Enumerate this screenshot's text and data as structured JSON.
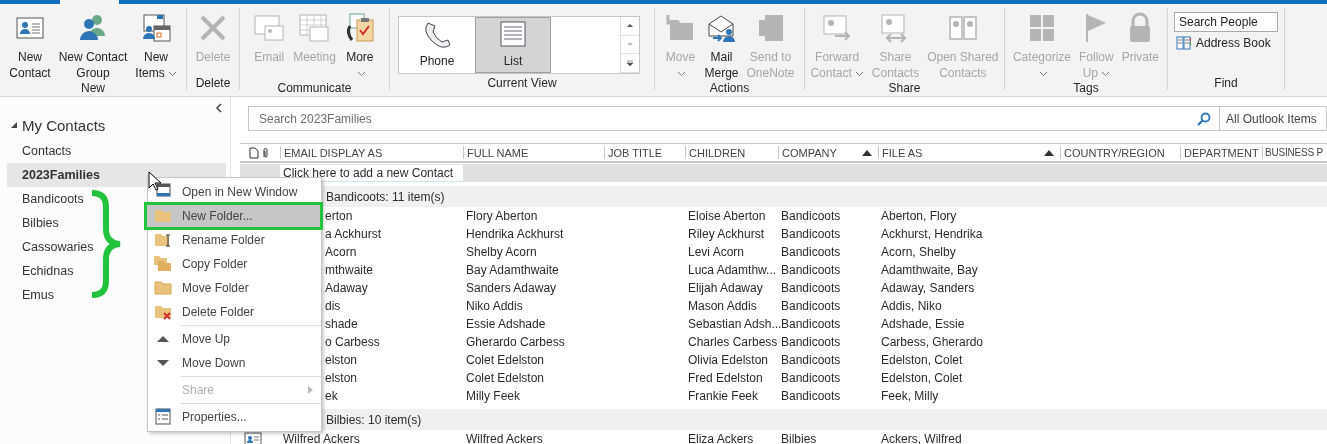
{
  "ribbon": {
    "groups": [
      {
        "label": "New",
        "buttons": [
          {
            "label": "New\nContact",
            "disabled": false,
            "dropdown": false
          },
          {
            "label": "New Contact\nGroup",
            "disabled": false,
            "dropdown": false
          },
          {
            "label": "New\nItems",
            "disabled": false,
            "dropdown": true
          }
        ]
      },
      {
        "label": "Delete",
        "buttons": [
          {
            "label": "Delete",
            "disabled": true,
            "dropdown": false
          }
        ]
      },
      {
        "label": "Communicate",
        "buttons": [
          {
            "label": "Email",
            "disabled": true,
            "dropdown": false
          },
          {
            "label": "Meeting",
            "disabled": true,
            "dropdown": false
          },
          {
            "label": "More",
            "disabled": false,
            "dropdown": true
          }
        ]
      },
      {
        "label": "Current View",
        "gallery": [
          {
            "label": "Phone",
            "selected": false
          },
          {
            "label": "List",
            "selected": true
          }
        ]
      },
      {
        "label": "Actions",
        "buttons": [
          {
            "label": "Move",
            "disabled": true,
            "dropdown": true
          },
          {
            "label": "Mail\nMerge",
            "disabled": false,
            "dropdown": false
          },
          {
            "label": "Send to\nOneNote",
            "disabled": true,
            "dropdown": false
          }
        ]
      },
      {
        "label": "Share",
        "buttons": [
          {
            "label": "Forward\nContact",
            "disabled": true,
            "dropdown": true
          },
          {
            "label": "Share\nContacts",
            "disabled": true,
            "dropdown": false
          },
          {
            "label": "Open Shared\nContacts",
            "disabled": true,
            "dropdown": false
          }
        ]
      },
      {
        "label": "Tags",
        "buttons": [
          {
            "label": "Categorize",
            "disabled": true,
            "dropdown": true
          },
          {
            "label": "Follow\nUp",
            "disabled": true,
            "dropdown": true
          },
          {
            "label": "Private",
            "disabled": true,
            "dropdown": false
          }
        ]
      },
      {
        "label": "Find",
        "search": {
          "placeholder": "Search People"
        },
        "links": [
          {
            "label": "Address Book"
          }
        ]
      }
    ]
  },
  "sidebar": {
    "header": {
      "label": "My Contacts",
      "expanded": true
    },
    "items": [
      {
        "label": "Contacts",
        "selected": false
      },
      {
        "label": "2023Families",
        "selected": true
      },
      {
        "label": "Bandicoots",
        "selected": false
      },
      {
        "label": "Bilbies",
        "selected": false
      },
      {
        "label": "Cassowaries",
        "selected": false
      },
      {
        "label": "Echidnas",
        "selected": false
      },
      {
        "label": "Emus",
        "selected": false
      }
    ]
  },
  "context_menu": {
    "items": [
      {
        "kind": "item",
        "label": "Open in New Window",
        "selected": false,
        "disabled": false,
        "submenu": false
      },
      {
        "kind": "item",
        "label": "New Folder...",
        "selected": true,
        "disabled": false,
        "submenu": false
      },
      {
        "kind": "item",
        "label": "Rename Folder",
        "selected": false,
        "disabled": false,
        "submenu": false
      },
      {
        "kind": "item",
        "label": "Copy Folder",
        "selected": false,
        "disabled": false,
        "submenu": false
      },
      {
        "kind": "item",
        "label": "Move Folder",
        "selected": false,
        "disabled": false,
        "submenu": false
      },
      {
        "kind": "item",
        "label": "Delete Folder",
        "selected": false,
        "disabled": false,
        "submenu": false
      },
      {
        "kind": "separator"
      },
      {
        "kind": "item",
        "label": "Move Up",
        "selected": false,
        "disabled": false,
        "submenu": false
      },
      {
        "kind": "item",
        "label": "Move Down",
        "selected": false,
        "disabled": false,
        "submenu": false
      },
      {
        "kind": "separator"
      },
      {
        "kind": "item",
        "label": "Share",
        "selected": false,
        "disabled": true,
        "submenu": true
      },
      {
        "kind": "separator"
      },
      {
        "kind": "item",
        "label": "Properties...",
        "selected": false,
        "disabled": false,
        "submenu": false
      }
    ]
  },
  "table": {
    "search": {
      "placeholder": "Search 2023Families",
      "scope": "All Outlook Items"
    },
    "columns": [
      {
        "label": "EMAIL DISPLAY AS"
      },
      {
        "label": "FULL NAME"
      },
      {
        "label": "JOB TITLE"
      },
      {
        "label": "CHILDREN"
      },
      {
        "label": "COMPANY",
        "sorted_ascending": true
      },
      {
        "label": "FILE AS",
        "sorted_ascending": true
      },
      {
        "label": "COUNTRY/REGION"
      },
      {
        "label": "DEPARTMENT"
      },
      {
        "label": "BUSINESS P"
      }
    ],
    "new_row": "Click here to add a new Contact",
    "groups": [
      {
        "header": "Bandicoots: 11 item(s)",
        "rows": [
          {
            "email": "erton",
            "full_name": "Flory Aberton",
            "children": "Eloise Aberton",
            "company": "Bandicoots",
            "file_as": "Aberton, Flory"
          },
          {
            "email": "a Ackhurst",
            "full_name": "Hendrika Ackhurst",
            "children": "Riley Ackhurst",
            "company": "Bandicoots",
            "file_as": "Ackhurst, Hendrika"
          },
          {
            "email": "Acorn",
            "full_name": "Shelby Acorn",
            "children": "Levi Acorn",
            "company": "Bandicoots",
            "file_as": "Acorn, Shelby"
          },
          {
            "email": "mthwaite",
            "full_name": "Bay Adamthwaite",
            "children": "Luca Adamthw...",
            "company": "Bandicoots",
            "file_as": "Adamthwaite, Bay"
          },
          {
            "email": "Adaway",
            "full_name": "Sanders Adaway",
            "children": "Elijah Adaway",
            "company": "Bandicoots",
            "file_as": "Adaway, Sanders"
          },
          {
            "email": "dis",
            "full_name": "Niko Addis",
            "children": "Mason Addis",
            "company": "Bandicoots",
            "file_as": "Addis, Niko"
          },
          {
            "email": "shade",
            "full_name": "Essie Adshade",
            "children": "Sebastian Adsh...",
            "company": "Bandicoots",
            "file_as": "Adshade, Essie"
          },
          {
            "email": "o Carbess",
            "full_name": "Gherardo Carbess",
            "children": "Charles Carbess",
            "company": "Bandicoots",
            "file_as": "Carbess, Gherardo"
          },
          {
            "email": "elston",
            "full_name": "Colet Edelston",
            "children": "Olivia Edelston",
            "company": "Bandicoots",
            "file_as": "Edelston, Colet"
          },
          {
            "email": "elston",
            "full_name": "Colet Edelston",
            "children": "Fred Edelston",
            "company": "Bandicoots",
            "file_as": "Edelston, Colet"
          },
          {
            "email": "ek",
            "full_name": "Milly Feek",
            "children": "Frankie Feek",
            "company": "Bandicoots",
            "file_as": "Feek, Milly"
          }
        ]
      },
      {
        "header": "Bilbies: 10 item(s)",
        "rows": [
          {
            "contact_icon": true,
            "email": "Wilfred Ackers",
            "full_name": "Wilfred Ackers",
            "children": "Eliza Ackers",
            "company": "Bilbies",
            "file_as": "Ackers, Wilfred"
          }
        ]
      }
    ]
  }
}
